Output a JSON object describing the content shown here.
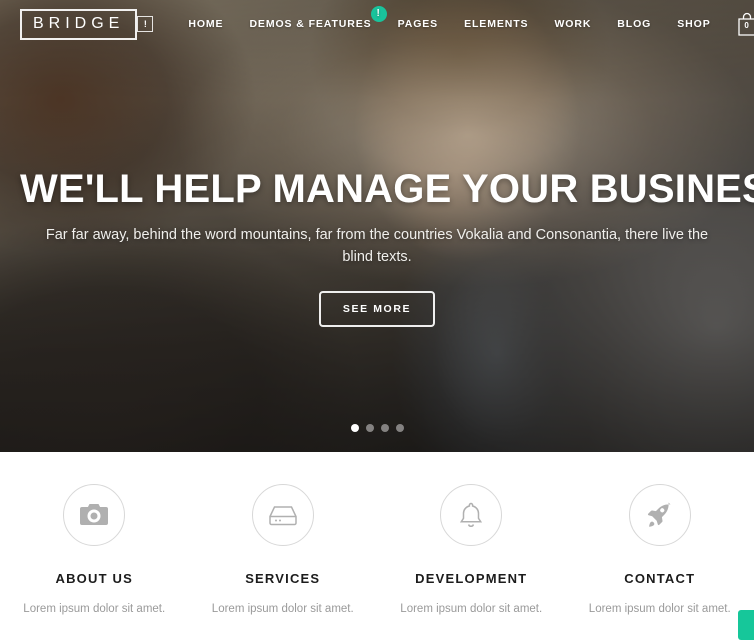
{
  "header": {
    "logo_text": "BRIDGE",
    "alert_box_icon": "exclamation-box-icon",
    "alert_box_label": "!",
    "nav_items": [
      {
        "label": "HOME",
        "badge": null
      },
      {
        "label": "DEMOS & FEATURES",
        "badge": "!"
      },
      {
        "label": "PAGES",
        "badge": null
      },
      {
        "label": "ELEMENTS",
        "badge": null
      },
      {
        "label": "WORK",
        "badge": null
      },
      {
        "label": "BLOG",
        "badge": null
      },
      {
        "label": "SHOP",
        "badge": null
      }
    ],
    "cart": {
      "icon": "shopping-bag-icon",
      "count": "0"
    },
    "search_icon": "search-icon",
    "menu_icon": "hamburger-menu-icon",
    "badge_color": "#19c39c"
  },
  "hero": {
    "title": "WE'LL HELP MANAGE YOUR BUSINESS",
    "subtitle": "Far far away, behind the word mountains, far from the countries Vokalia and Consonantia, there live the blind texts.",
    "cta_label": "SEE MORE",
    "slider": {
      "total": 4,
      "active_index": 0
    }
  },
  "features": [
    {
      "icon": "camera-icon",
      "title": "ABOUT US",
      "text": "Lorem ipsum dolor sit amet."
    },
    {
      "icon": "server-icon",
      "title": "SERVICES",
      "text": "Lorem ipsum dolor sit amet."
    },
    {
      "icon": "bell-icon",
      "title": "DEVELOPMENT",
      "text": "Lorem ipsum dolor sit amet."
    },
    {
      "icon": "rocket-icon",
      "title": "CONTACT",
      "text": "Lorem ipsum dolor sit amet."
    }
  ],
  "corner_button": {
    "icon": "side-tab-button",
    "color": "#16c79a"
  }
}
